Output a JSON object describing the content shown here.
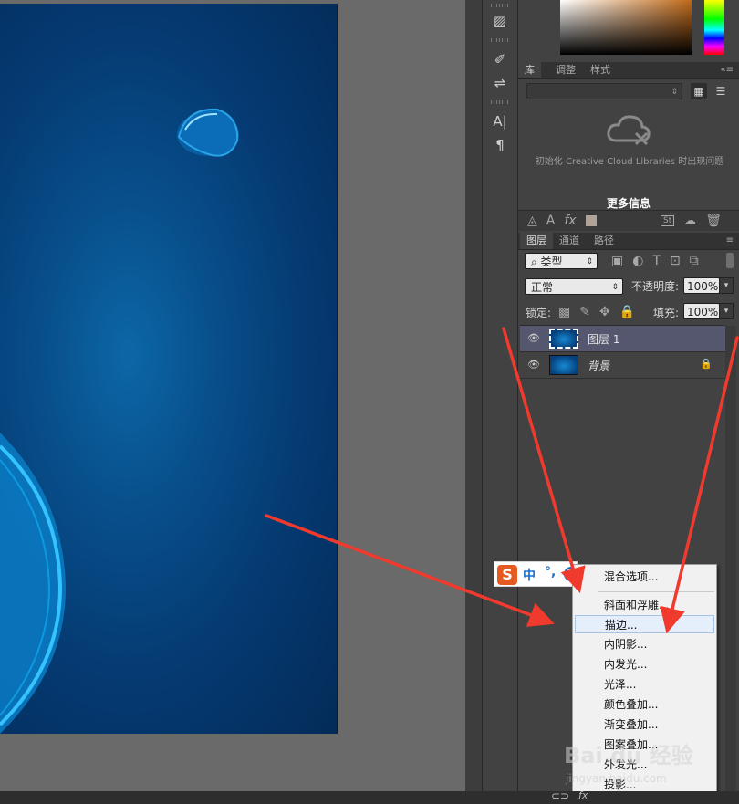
{
  "panels": {
    "library": {
      "tabs": [
        "库",
        "调整",
        "样式"
      ],
      "message": "初始化 Creative Cloud Libraries 时出现问题",
      "more_info": "更多信息"
    },
    "layers": {
      "tabs": [
        "图层",
        "通道",
        "路径"
      ],
      "filter_kind": "类型",
      "blend_mode": "正常",
      "opacity_label": "不透明度:",
      "opacity_value": "100%",
      "lock_label": "锁定:",
      "fill_label": "填充:",
      "fill_value": "100%",
      "items": [
        {
          "name": "图层 1",
          "selected": true
        },
        {
          "name": "背景",
          "selected": false,
          "locked": true
        }
      ]
    }
  },
  "ime": {
    "zh": "中",
    "punc": "°,"
  },
  "context_menu": {
    "items": [
      "混合选项...",
      "斜面和浮雕...",
      "描边...",
      "内阴影...",
      "内发光...",
      "光泽...",
      "颜色叠加...",
      "渐变叠加...",
      "图案叠加...",
      "外发光...",
      "投影..."
    ],
    "highlighted_index": 2
  },
  "watermark": {
    "text": "Bai du 经验",
    "sub": "jingyan.baidu.com"
  },
  "colors": {
    "arrow": "#f03a2e",
    "selected_layer": "#54576d",
    "menu_highlight": "#e5eefb"
  }
}
